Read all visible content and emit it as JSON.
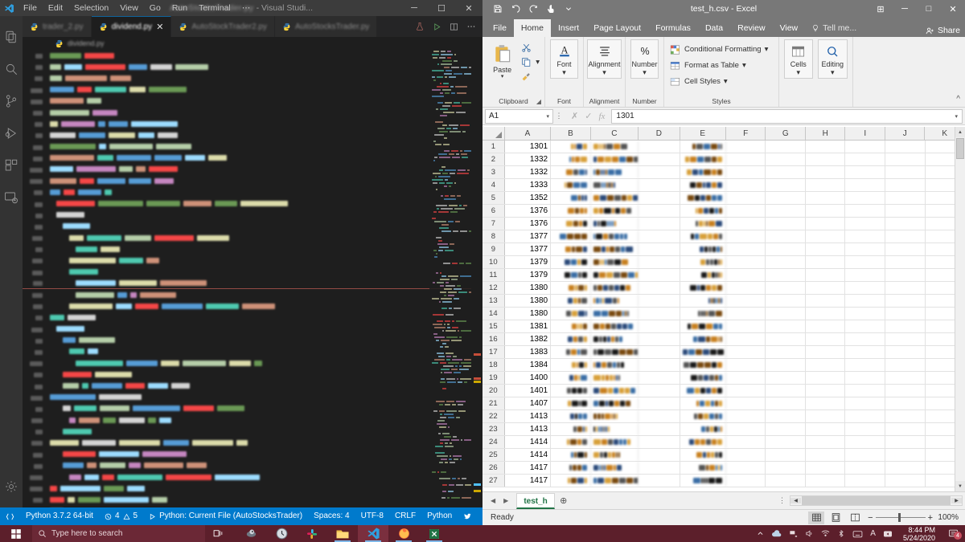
{
  "vscode": {
    "menu": [
      "File",
      "Edit",
      "Selection",
      "View",
      "Go",
      "Run",
      "Terminal",
      "⋯"
    ],
    "title_blurred": "AutoStocksTrader.py",
    "title_suffix": "- Visual Studi...",
    "window_buttons": {
      "minimize": "─",
      "maximize": "☐",
      "close": "✕"
    },
    "tabs": [
      {
        "label": "trader_2.py",
        "active": false,
        "icon": "python-icon"
      },
      {
        "label": "dividend.py",
        "active": true,
        "icon": "python-icon",
        "close": "✕"
      },
      {
        "label": "AutoStockTrader2.py",
        "active": false,
        "icon": "python-icon"
      },
      {
        "label": "AutoStocksTrader.py",
        "active": false,
        "icon": "python-icon"
      }
    ],
    "tab_actions": [
      "beaker-test-icon",
      "run-play-icon",
      "split-editor-icon",
      "more-actions-icon"
    ],
    "activitybar": [
      "explorer-icon",
      "search-icon",
      "source-control-icon",
      "run-and-debug-icon",
      "extensions-icon",
      "remote-explorer-icon",
      "settings-gear-icon"
    ],
    "statusbar": {
      "remote_icon": "remote-icon",
      "python_version": "Python 3.7.2 64-bit",
      "errors": "4",
      "warnings": "5",
      "run_config": "Python: Current File (AutoStocksTrader)",
      "spaces": "Spaces: 4",
      "encoding": "UTF-8",
      "eol": "CRLF",
      "language": "Python",
      "feedback_icon": "tweet-feedback-icon",
      "bell_icon": "notifications-bell-icon"
    },
    "editor_note": "code content is pixelated / redacted in the screenshot"
  },
  "excel": {
    "title": "test_h.csv - Excel",
    "quick_access": [
      "save-icon",
      "undo-icon",
      "redo-icon",
      "touch-mode-icon",
      "customize-qat-icon"
    ],
    "window_buttons": {
      "ribbon_display": "⊞",
      "minimize": "─",
      "maximize": "□",
      "close": "✕"
    },
    "ribbon_tabs": [
      "File",
      "Home",
      "Insert",
      "Page Layout",
      "Formulas",
      "Data",
      "Review",
      "View"
    ],
    "active_ribbon_tab": "Home",
    "tell_me": "Tell me...",
    "share": "Share",
    "ribbon_groups": [
      {
        "name": "Clipboard",
        "buttons": [
          "Paste"
        ],
        "small_buttons": [
          "Cut",
          "Copy",
          "Format Painter"
        ]
      },
      {
        "name": "Font",
        "buttons": [
          "Font"
        ]
      },
      {
        "name": "Alignment",
        "buttons": [
          "Alignment"
        ]
      },
      {
        "name": "Number",
        "buttons": [
          "Number"
        ]
      },
      {
        "name": "Styles",
        "small_buttons": [
          "Conditional Formatting",
          "Format as Table",
          "Cell Styles"
        ]
      },
      {
        "name": "",
        "buttons": [
          "Cells",
          "Editing"
        ]
      }
    ],
    "name_box": "A1",
    "formula_value": "1301",
    "columns": [
      "A",
      "B",
      "C",
      "D",
      "E",
      "F",
      "G",
      "H",
      "I",
      "J",
      "K"
    ],
    "rows": [
      {
        "n": "1",
        "a": "1301"
      },
      {
        "n": "2",
        "a": "1332"
      },
      {
        "n": "3",
        "a": "1332"
      },
      {
        "n": "4",
        "a": "1333"
      },
      {
        "n": "5",
        "a": "1352"
      },
      {
        "n": "6",
        "a": "1376"
      },
      {
        "n": "7",
        "a": "1376"
      },
      {
        "n": "8",
        "a": "1377"
      },
      {
        "n": "9",
        "a": "1377"
      },
      {
        "n": "10",
        "a": "1379"
      },
      {
        "n": "11",
        "a": "1379"
      },
      {
        "n": "12",
        "a": "1380"
      },
      {
        "n": "13",
        "a": "1380"
      },
      {
        "n": "14",
        "a": "1380"
      },
      {
        "n": "15",
        "a": "1381"
      },
      {
        "n": "16",
        "a": "1382"
      },
      {
        "n": "17",
        "a": "1383"
      },
      {
        "n": "18",
        "a": "1384"
      },
      {
        "n": "19",
        "a": "1400"
      },
      {
        "n": "20",
        "a": "1401"
      },
      {
        "n": "21",
        "a": "1407"
      },
      {
        "n": "22",
        "a": "1413"
      },
      {
        "n": "23",
        "a": "1413"
      },
      {
        "n": "24",
        "a": "1414"
      },
      {
        "n": "25",
        "a": "1414"
      },
      {
        "n": "26",
        "a": "1417"
      },
      {
        "n": "27",
        "a": "1417"
      }
    ],
    "sheet_tab": "test_h",
    "add_sheet": "⊕",
    "status": "Ready",
    "zoom": "100%",
    "view_buttons": [
      "normal-view-icon",
      "page-layout-view-icon",
      "page-break-view-icon"
    ]
  },
  "taskbar": {
    "start": "windows-start-icon",
    "search_placeholder": "Type here to search",
    "task_view": "task-view-icon",
    "apps": [
      "cortana-icon",
      "clock-app-icon",
      "slack-icon",
      "file-explorer-icon",
      "vscode-icon",
      "firefox-icon",
      "excel-icon"
    ],
    "tray": [
      "show-hidden-icons-chevron",
      "onedrive-icon",
      "network-icon",
      "volume-icon",
      "wifi-icon",
      "bluetooth-icon",
      "keyboard-icon",
      "language-indicator",
      "meet-now-icon"
    ],
    "language": "A",
    "time": "8:44 PM",
    "date": "5/24/2020",
    "notification_count": "4"
  }
}
